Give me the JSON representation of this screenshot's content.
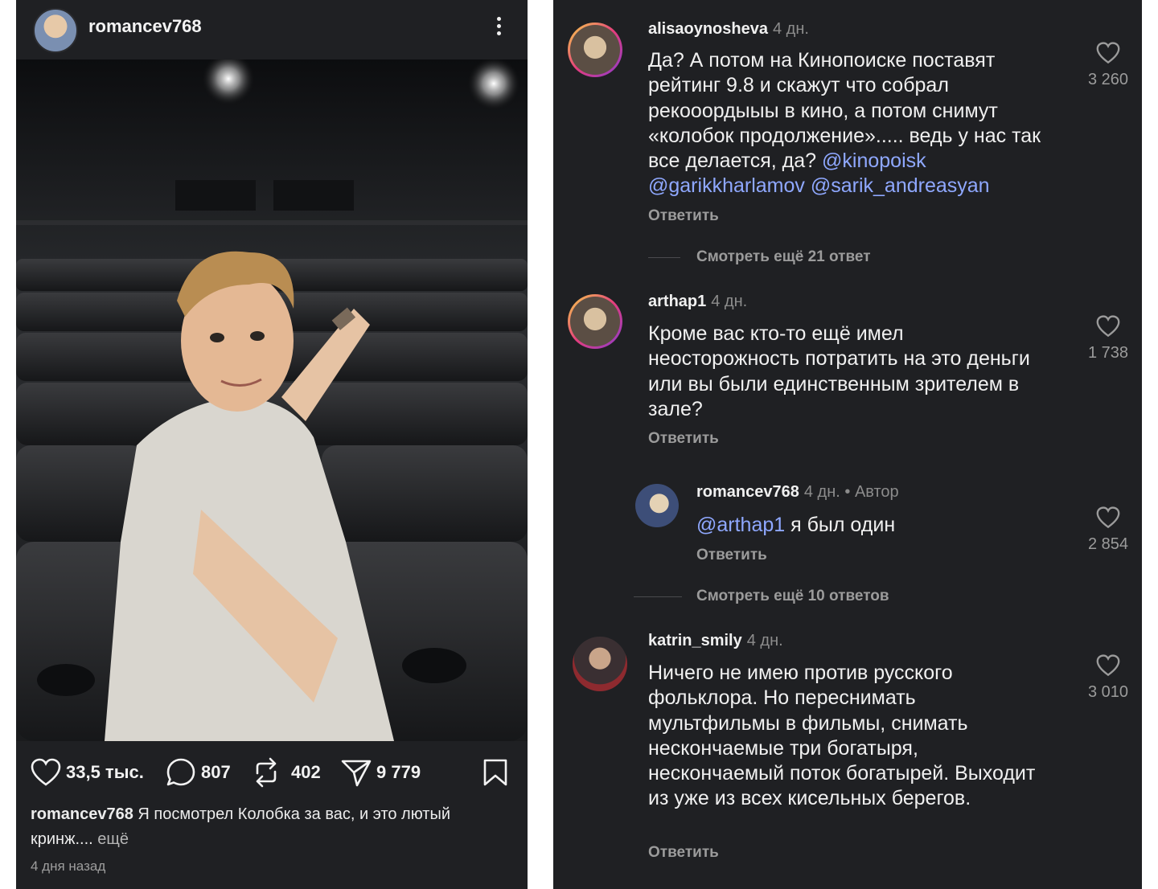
{
  "post": {
    "username": "romancev768",
    "likes": "33,5 тыс.",
    "comments": "807",
    "reposts": "402",
    "shares": "9 779",
    "caption_user": "romancev768",
    "caption_text": " Я посмотрел Колобка за вас, и это лютый кринж....",
    "caption_more": " ещё",
    "time": "4 дня назад"
  },
  "comments": [
    {
      "user": "alisaoynosheva",
      "time": "4 дн.",
      "text": "Да? А потом на Кинопоиске поставят рейтинг 9.8 и скажут что собрал рекооордыыы в кино, а потом снимут «колобок продолжение»..... ведь у нас так все делается, да? ",
      "mentions": [
        "@kinopoisk",
        "@garikkharlamov",
        "@sarik_andreasyan"
      ],
      "reply": "Ответить",
      "likes": "3 260",
      "view_more": "Смотреть ещё 21 ответ"
    },
    {
      "user": "arthap1",
      "time": "4 дн.",
      "text": "Кроме вас кто-то ещё имел неосторожность потратить на это деньги или вы были единственным зрителем в зале?",
      "reply": "Ответить",
      "likes": "1 738"
    },
    {
      "user": "romancev768",
      "time": "4 дн.",
      "author": " • Автор",
      "mention": "@arthap1",
      "text": " я был один",
      "reply": "Ответить",
      "likes": "2 854",
      "view_more": "Смотреть ещё 10 ответов"
    },
    {
      "user": "katrin_smily",
      "time": "4 дн.",
      "text": "Ничего не имею против русского фольклора. Но переснимать мультфильмы в фильмы, снимать нескончаемые три богатыря, нескончаемый поток богатырей. Выходит из уже из всех кисельных берегов.",
      "reply": "Ответить",
      "likes": "3 010"
    }
  ],
  "colors": {
    "background": "#1f2023",
    "mention": "#8fa8ff",
    "muted": "#9b9b9b"
  }
}
